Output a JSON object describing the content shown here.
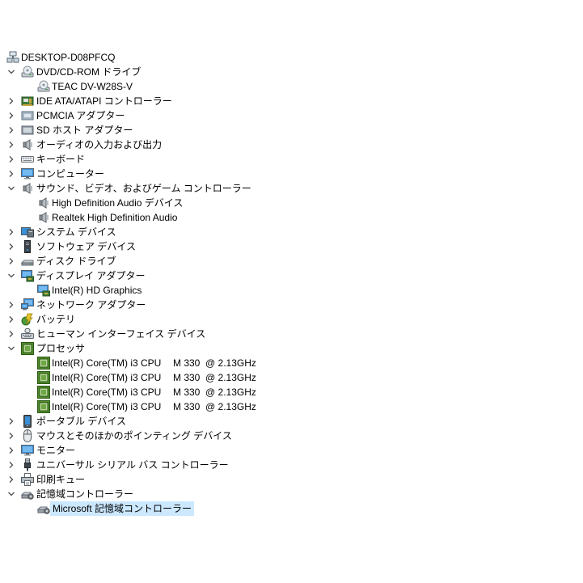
{
  "tree": [
    {
      "label": "DESKTOP-D08PFCQ",
      "icon": "computer-root-icon",
      "depth": 0,
      "expander": "none"
    },
    {
      "label": "DVD/CD-ROM ドライブ",
      "icon": "dvd-drive-icon",
      "depth": 1,
      "expander": "open"
    },
    {
      "label": "TEAC DV-W28S-V",
      "icon": "dvd-drive-icon",
      "depth": 2,
      "expander": "none"
    },
    {
      "label": "IDE ATA/ATAPI コントローラー",
      "icon": "ide-controller-icon",
      "depth": 1,
      "expander": "closed"
    },
    {
      "label": "PCMCIA アダプター",
      "icon": "pcmcia-icon",
      "depth": 1,
      "expander": "closed"
    },
    {
      "label": "SD ホスト アダプター",
      "icon": "sd-host-icon",
      "depth": 1,
      "expander": "closed"
    },
    {
      "label": "オーディオの入力および出力",
      "icon": "speaker-icon",
      "depth": 1,
      "expander": "closed"
    },
    {
      "label": "キーボード",
      "icon": "keyboard-icon",
      "depth": 1,
      "expander": "closed"
    },
    {
      "label": "コンピューター",
      "icon": "monitor-icon",
      "depth": 1,
      "expander": "closed"
    },
    {
      "label": "サウンド、ビデオ、およびゲーム コントローラー",
      "icon": "speaker-icon",
      "depth": 1,
      "expander": "open"
    },
    {
      "label": "High Definition Audio デバイス",
      "icon": "speaker-icon",
      "depth": 2,
      "expander": "none"
    },
    {
      "label": "Realtek High Definition Audio",
      "icon": "speaker-icon",
      "depth": 2,
      "expander": "none"
    },
    {
      "label": "システム デバイス",
      "icon": "system-device-icon",
      "depth": 1,
      "expander": "closed"
    },
    {
      "label": "ソフトウェア デバイス",
      "icon": "software-device-icon",
      "depth": 1,
      "expander": "closed"
    },
    {
      "label": "ディスク ドライブ",
      "icon": "disk-drive-icon",
      "depth": 1,
      "expander": "closed"
    },
    {
      "label": "ディスプレイ アダプター",
      "icon": "display-adapter-icon",
      "depth": 1,
      "expander": "open"
    },
    {
      "label": "Intel(R) HD Graphics",
      "icon": "display-adapter-icon",
      "depth": 2,
      "expander": "none"
    },
    {
      "label": "ネットワーク アダプター",
      "icon": "network-adapter-icon",
      "depth": 1,
      "expander": "closed"
    },
    {
      "label": "バッテリ",
      "icon": "battery-icon",
      "depth": 1,
      "expander": "closed"
    },
    {
      "label": "ヒューマン インターフェイス デバイス",
      "icon": "hid-icon",
      "depth": 1,
      "expander": "closed"
    },
    {
      "label": "プロセッサ",
      "icon": "processor-icon",
      "depth": 1,
      "expander": "open"
    },
    {
      "label": "Intel(R) Core(TM) i3 CPU",
      "label_b": "M 330  @ 2.13GHz",
      "icon": "processor-icon",
      "depth": 2,
      "expander": "none"
    },
    {
      "label": "Intel(R) Core(TM) i3 CPU",
      "label_b": "M 330  @ 2.13GHz",
      "icon": "processor-icon",
      "depth": 2,
      "expander": "none"
    },
    {
      "label": "Intel(R) Core(TM) i3 CPU",
      "label_b": "M 330  @ 2.13GHz",
      "icon": "processor-icon",
      "depth": 2,
      "expander": "none"
    },
    {
      "label": "Intel(R) Core(TM) i3 CPU",
      "label_b": "M 330  @ 2.13GHz",
      "icon": "processor-icon",
      "depth": 2,
      "expander": "none"
    },
    {
      "label": "ポータブル デバイス",
      "icon": "portable-device-icon",
      "depth": 1,
      "expander": "closed"
    },
    {
      "label": "マウスとそのほかのポインティング デバイス",
      "icon": "mouse-icon",
      "depth": 1,
      "expander": "closed"
    },
    {
      "label": "モニター",
      "icon": "monitor-icon",
      "depth": 1,
      "expander": "closed"
    },
    {
      "label": "ユニバーサル シリアル バス コントローラー",
      "icon": "usb-icon",
      "depth": 1,
      "expander": "closed"
    },
    {
      "label": "印刷キュー",
      "icon": "printer-icon",
      "depth": 1,
      "expander": "closed"
    },
    {
      "label": "記憶域コントローラー",
      "icon": "storage-controller-icon",
      "depth": 1,
      "expander": "open"
    },
    {
      "label": "Microsoft 記憶域コントローラー",
      "icon": "storage-controller-icon",
      "depth": 2,
      "expander": "none",
      "selected": true
    }
  ],
  "colors": {
    "selection": "#cce8ff",
    "chevron": "#4d4d4d",
    "chip_green": "#4f8a2b"
  }
}
